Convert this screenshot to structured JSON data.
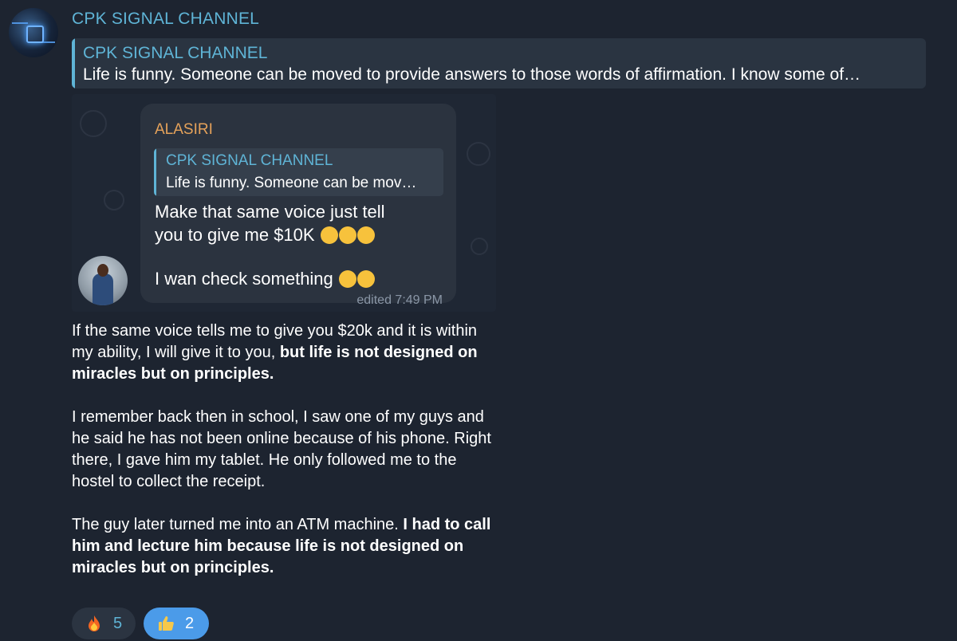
{
  "channel": {
    "name": "CPK SIGNAL CHANNEL"
  },
  "reply_preview": {
    "title": "CPK SIGNAL CHANNEL",
    "text": "Life is funny. Someone can be moved to provide answers to those words of affirmation. I know some of…"
  },
  "screenshot": {
    "sender": "ALASIRI",
    "reply_title": "CPK SIGNAL CHANNEL",
    "reply_text": "Life is funny. Someone can be mov…",
    "message_line1": "Make that same voice just tell",
    "message_line2": "you to give me $10K",
    "message_line3": "I wan check something",
    "edited": "edited 7:49 PM"
  },
  "post": {
    "p1_normal": "If the same voice tells me to give you $20k and it is within my ability, I will give it to  you, ",
    "p1_bold": "but life is not designed on miracles but on principles.",
    "p2": "I remember back then in school, I saw one of my guys and he said he has not been online because of his phone. Right there, I gave him my tablet. He only followed me to the hostel to collect the receipt.",
    "p3_normal": "The guy later turned me into an ATM machine. ",
    "p3_bold": "I had to call him and lecture him because life is not designed on miracles but on principles."
  },
  "reactions": [
    {
      "icon": "fire-icon",
      "count": "5"
    },
    {
      "icon": "thumbs-up-icon",
      "count": "2"
    }
  ],
  "colors": {
    "background": "#1d2430",
    "accent": "#5fb4d6",
    "sender_orange": "#e5a25a",
    "reaction_active": "#4b9be9"
  }
}
